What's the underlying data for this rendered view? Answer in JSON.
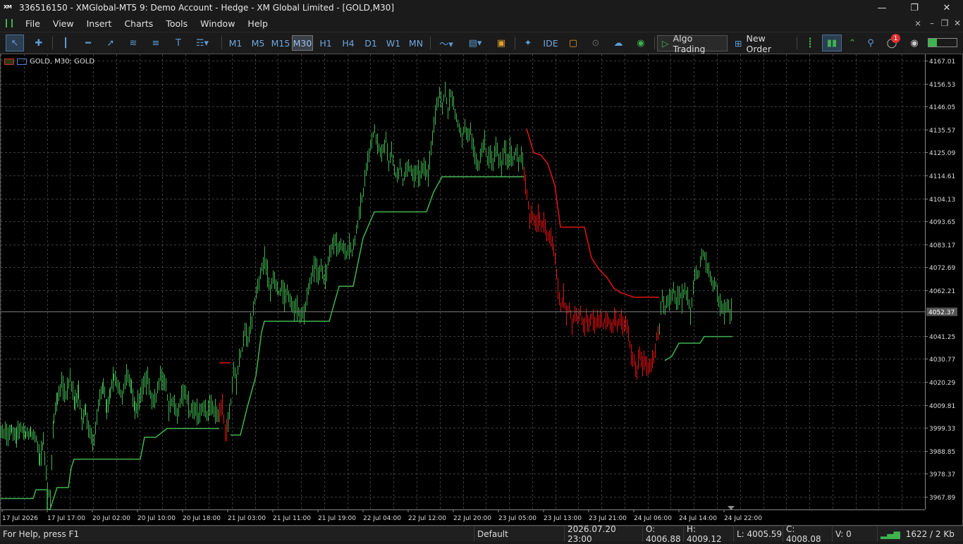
{
  "window": {
    "title": "336516150 - XMGlobal-MT5 9: Demo Account - Hedge - XM Global Limited - [GOLD,M30]",
    "logo_text": "XM"
  },
  "menu": [
    "File",
    "View",
    "Insert",
    "Charts",
    "Tools",
    "Window",
    "Help"
  ],
  "timeframes": [
    "M1",
    "M5",
    "M15",
    "M30",
    "H1",
    "H4",
    "D1",
    "W1",
    "MN"
  ],
  "active_timeframe": "M30",
  "toolbar": {
    "ide_label": "IDE",
    "algo_trading_label": "Algo Trading",
    "new_order_label": "New Order",
    "notification_count": "1"
  },
  "chart": {
    "symbol_label": "GOLD, M30:  GOLD",
    "current_price": "4052.37",
    "price_labels": [
      "4167.01",
      "4156.53",
      "4146.05",
      "4135.57",
      "4125.09",
      "4114.61",
      "4104.13",
      "4093.65",
      "4083.17",
      "4072.69",
      "4062.21",
      "4041.25",
      "4030.77",
      "4020.29",
      "4009.81",
      "3999.33",
      "3988.85",
      "3978.37",
      "3967.89"
    ],
    "time_labels": [
      "17 Jul 2026",
      "17 Jul 17:00",
      "20 Jul 02:00",
      "20 Jul 10:00",
      "20 Jul 18:00",
      "21 Jul 03:00",
      "21 Jul 11:00",
      "21 Jul 19:00",
      "22 Jul 04:00",
      "22 Jul 12:00",
      "22 Jul 20:00",
      "23 Jul 05:00",
      "23 Jul 13:00",
      "23 Jul 21:00",
      "24 Jul 06:00",
      "24 Jul 14:00",
      "24 Jul 22:00"
    ],
    "colors": {
      "bull": "#3fb34f",
      "bear": "#e21414",
      "grid": "#3c3c3c",
      "background": "#000000",
      "axis_text": "#dddddd"
    }
  },
  "chart_data": {
    "type": "candlestick",
    "symbol": "GOLD",
    "timeframe": "M30",
    "ylim": [
      3962,
      4170
    ],
    "close_segments": [
      {
        "color": "bull",
        "points": [
          [
            0,
            3999
          ],
          [
            8,
            3995
          ],
          [
            15,
            3998
          ],
          [
            22,
            3996
          ],
          [
            28,
            3999
          ],
          [
            35,
            3996
          ],
          [
            42,
            3997
          ],
          [
            50,
            3994
          ],
          [
            55,
            3985
          ],
          [
            60,
            3993
          ],
          [
            66,
            3972
          ],
          [
            70,
            3968
          ],
          [
            75,
            4003
          ],
          [
            80,
            4013
          ],
          [
            86,
            4019
          ],
          [
            92,
            4015
          ],
          [
            98,
            4022
          ],
          [
            105,
            4011
          ],
          [
            110,
            4017
          ],
          [
            115,
            4002
          ],
          [
            120,
            4007
          ],
          [
            126,
            3997
          ],
          [
            132,
            3993
          ],
          [
            138,
            4010
          ],
          [
            145,
            4019
          ],
          [
            150,
            4008
          ],
          [
            155,
            4015
          ],
          [
            160,
            4023
          ],
          [
            166,
            4018
          ],
          [
            172,
            4014
          ],
          [
            178,
            4023
          ],
          [
            185,
            4017
          ],
          [
            190,
            4008
          ],
          [
            196,
            4012
          ],
          [
            202,
            4019
          ],
          [
            208,
            4022
          ],
          [
            214,
            4011
          ],
          [
            220,
            4013
          ],
          [
            226,
            4024
          ],
          [
            232,
            4021
          ],
          [
            238,
            4009
          ],
          [
            244,
            4012
          ],
          [
            250,
            4005
          ],
          [
            256,
            4013
          ],
          [
            262,
            4016
          ],
          [
            268,
            4006
          ],
          [
            274,
            4009
          ],
          [
            280,
            4005
          ],
          [
            286,
            4008
          ],
          [
            292,
            4006
          ],
          [
            298,
            4010
          ],
          [
            304,
            4007
          ],
          [
            310,
            4005
          ]
        ]
      },
      {
        "color": "bear",
        "points": [
          [
            310,
            4005
          ],
          [
            314,
            4010
          ],
          [
            318,
            3997
          ],
          [
            322,
            4003
          ]
        ]
      },
      {
        "color": "bull",
        "points": [
          [
            322,
            4003
          ],
          [
            326,
            4011
          ],
          [
            330,
            4025
          ],
          [
            334,
            4021
          ],
          [
            338,
            4032
          ],
          [
            342,
            4035
          ],
          [
            346,
            4043
          ],
          [
            350,
            4040
          ],
          [
            354,
            4045
          ],
          [
            358,
            4053
          ],
          [
            362,
            4061
          ],
          [
            366,
            4067
          ],
          [
            370,
            4073
          ],
          [
            374,
            4076
          ],
          [
            378,
            4070
          ],
          [
            382,
            4062
          ],
          [
            386,
            4068
          ],
          [
            390,
            4065
          ],
          [
            394,
            4061
          ],
          [
            398,
            4063
          ],
          [
            402,
            4059
          ],
          [
            406,
            4063
          ],
          [
            410,
            4058
          ],
          [
            414,
            4053
          ],
          [
            418,
            4055
          ],
          [
            422,
            4052
          ],
          [
            426,
            4050
          ],
          [
            430,
            4051
          ],
          [
            434,
            4058
          ],
          [
            438,
            4065
          ],
          [
            442,
            4071
          ],
          [
            446,
            4074
          ],
          [
            450,
            4069
          ],
          [
            454,
            4072
          ],
          [
            458,
            4066
          ],
          [
            462,
            4071
          ],
          [
            466,
            4078
          ],
          [
            470,
            4082
          ],
          [
            474,
            4085
          ],
          [
            478,
            4081
          ],
          [
            482,
            4083
          ],
          [
            486,
            4081
          ],
          [
            490,
            4079
          ],
          [
            494,
            4082
          ],
          [
            498,
            4079
          ],
          [
            502,
            4085
          ],
          [
            506,
            4093
          ],
          [
            510,
            4100
          ],
          [
            514,
            4108
          ],
          [
            518,
            4117
          ],
          [
            522,
            4124
          ],
          [
            526,
            4131
          ],
          [
            530,
            4135
          ],
          [
            534,
            4129
          ],
          [
            538,
            4124
          ],
          [
            542,
            4127
          ],
          [
            546,
            4131
          ],
          [
            550,
            4120
          ],
          [
            554,
            4127
          ],
          [
            558,
            4116
          ],
          [
            562,
            4114
          ],
          [
            566,
            4119
          ],
          [
            570,
            4112
          ],
          [
            574,
            4117
          ],
          [
            578,
            4120
          ],
          [
            582,
            4116
          ],
          [
            586,
            4114
          ],
          [
            590,
            4118
          ],
          [
            594,
            4114
          ],
          [
            598,
            4119
          ],
          [
            602,
            4117
          ],
          [
            606,
            4114
          ],
          [
            610,
            4126
          ],
          [
            614,
            4138
          ],
          [
            618,
            4146
          ],
          [
            622,
            4152
          ],
          [
            626,
            4145
          ],
          [
            630,
            4155
          ],
          [
            634,
            4143
          ],
          [
            638,
            4152
          ],
          [
            642,
            4146
          ],
          [
            646,
            4140
          ],
          [
            650,
            4136
          ],
          [
            654,
            4132
          ],
          [
            658,
            4138
          ],
          [
            662,
            4131
          ],
          [
            666,
            4136
          ],
          [
            670,
            4127
          ],
          [
            674,
            4122
          ],
          [
            678,
            4119
          ],
          [
            682,
            4126
          ],
          [
            686,
            4129
          ],
          [
            690,
            4121
          ],
          [
            694,
            4125
          ],
          [
            698,
            4119
          ],
          [
            702,
            4127
          ],
          [
            706,
            4123
          ],
          [
            710,
            4118
          ],
          [
            714,
            4128
          ],
          [
            718,
            4121
          ],
          [
            722,
            4125
          ],
          [
            726,
            4121
          ],
          [
            730,
            4125
          ],
          [
            734,
            4121
          ],
          [
            738,
            4124
          ],
          [
            742,
            4117
          ]
        ]
      },
      {
        "color": "bear",
        "points": [
          [
            742,
            4117
          ],
          [
            746,
            4105
          ],
          [
            750,
            4095
          ],
          [
            754,
            4097
          ],
          [
            758,
            4093
          ],
          [
            762,
            4095
          ],
          [
            766,
            4091
          ],
          [
            770,
            4094
          ],
          [
            774,
            4088
          ],
          [
            778,
            4086
          ],
          [
            782,
            4083
          ],
          [
            786,
            4077
          ],
          [
            790,
            4065
          ],
          [
            794,
            4055
          ],
          [
            798,
            4059
          ],
          [
            802,
            4052
          ],
          [
            806,
            4055
          ],
          [
            810,
            4047
          ],
          [
            814,
            4052
          ],
          [
            818,
            4049
          ],
          [
            822,
            4052
          ],
          [
            826,
            4045
          ],
          [
            830,
            4049
          ],
          [
            834,
            4046
          ],
          [
            838,
            4050
          ],
          [
            842,
            4046
          ],
          [
            846,
            4048
          ],
          [
            850,
            4049
          ],
          [
            854,
            4046
          ],
          [
            858,
            4050
          ],
          [
            862,
            4048
          ],
          [
            866,
            4046
          ],
          [
            870,
            4050
          ],
          [
            874,
            4047
          ],
          [
            878,
            4049
          ],
          [
            882,
            4046
          ],
          [
            886,
            4047
          ],
          [
            890,
            4044
          ],
          [
            894,
            4032
          ],
          [
            898,
            4029
          ],
          [
            902,
            4026
          ],
          [
            906,
            4032
          ],
          [
            910,
            4027
          ],
          [
            914,
            4029
          ],
          [
            918,
            4025
          ],
          [
            922,
            4028
          ],
          [
            926,
            4033
          ],
          [
            930,
            4040
          ],
          [
            934,
            4046
          ]
        ]
      },
      {
        "color": "bull",
        "points": [
          [
            934,
            4046
          ],
          [
            938,
            4058
          ],
          [
            942,
            4053
          ],
          [
            946,
            4057
          ],
          [
            950,
            4059
          ],
          [
            954,
            4062
          ],
          [
            958,
            4057
          ],
          [
            962,
            4061
          ],
          [
            966,
            4058
          ],
          [
            970,
            4063
          ],
          [
            974,
            4059
          ],
          [
            978,
            4050
          ],
          [
            982,
            4065
          ],
          [
            986,
            4071
          ],
          [
            990,
            4069
          ],
          [
            994,
            4080
          ],
          [
            998,
            4077
          ],
          [
            1002,
            4073
          ],
          [
            1006,
            4070
          ],
          [
            1010,
            4064
          ],
          [
            1014,
            4065
          ],
          [
            1018,
            4058
          ],
          [
            1022,
            4054
          ],
          [
            1026,
            4052
          ],
          [
            1030,
            4055
          ],
          [
            1034,
            4052
          ],
          [
            1038,
            4052
          ]
        ]
      }
    ],
    "supertrend": [
      {
        "color": "bull",
        "points": [
          [
            0,
            3967
          ],
          [
            46,
            3967
          ],
          [
            50,
            3971
          ],
          [
            66,
            3971
          ],
          [
            66,
            3962
          ],
          [
            70,
            3962
          ],
          [
            80,
            3972
          ],
          [
            96,
            3972
          ],
          [
            100,
            3981
          ],
          [
            104,
            3985
          ],
          [
            130,
            3985
          ],
          [
            198,
            3985
          ],
          [
            204,
            3995
          ],
          [
            220,
            3995
          ],
          [
            236,
            3999
          ],
          [
            310,
            3999
          ]
        ]
      },
      {
        "color": "bear",
        "points": [
          [
            310,
            4029
          ],
          [
            326,
            4029
          ]
        ]
      },
      {
        "color": "bull",
        "points": [
          [
            326,
            3996
          ],
          [
            340,
            3996
          ],
          [
            350,
            4009
          ],
          [
            362,
            4023
          ],
          [
            370,
            4043
          ],
          [
            374,
            4048
          ],
          [
            466,
            4048
          ],
          [
            480,
            4064
          ],
          [
            500,
            4064
          ],
          [
            514,
            4086
          ],
          [
            530,
            4098
          ],
          [
            604,
            4098
          ],
          [
            614,
            4107
          ],
          [
            626,
            4114
          ],
          [
            742,
            4114
          ]
        ]
      },
      {
        "color": "bear",
        "points": [
          [
            746,
            4136
          ],
          [
            756,
            4125
          ],
          [
            766,
            4124
          ],
          [
            776,
            4120
          ],
          [
            786,
            4110
          ],
          [
            794,
            4091
          ],
          [
            828,
            4091
          ],
          [
            838,
            4077
          ],
          [
            848,
            4072
          ],
          [
            860,
            4068
          ],
          [
            870,
            4063
          ],
          [
            880,
            4061
          ],
          [
            898,
            4059
          ],
          [
            934,
            4059
          ]
        ]
      },
      {
        "color": "bull",
        "points": [
          [
            942,
            4030
          ],
          [
            952,
            4032
          ],
          [
            962,
            4038
          ],
          [
            992,
            4038
          ],
          [
            998,
            4041
          ],
          [
            1038,
            4041
          ]
        ]
      }
    ]
  },
  "status": {
    "help": "For Help, press F1",
    "profile": "Default",
    "datetime": "2026.07.20 23:00",
    "open": "O: 4006.88",
    "high": "H: 4009.12",
    "low": "L: 4005.59",
    "close": "C: 4008.08",
    "volume": "V: 0",
    "traffic": "1622 / 2 Kb"
  }
}
